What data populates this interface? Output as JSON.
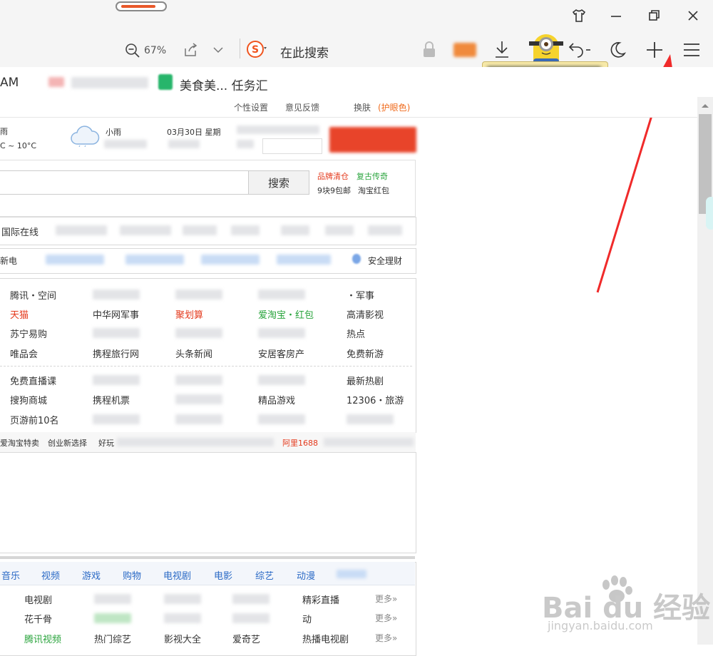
{
  "browser": {
    "zoom": "67%",
    "search_placeholder": "在此搜索",
    "bookmarks": [
      "AM",
      "美食美... 任务汇"
    ]
  },
  "topbar": {
    "settings_links": [
      "个性设置",
      "意见反馈",
      "换肤",
      "(护眼色)"
    ]
  },
  "weather": {
    "today_temp": "C ~ 10°C",
    "cond1": "雨",
    "cond2": "小雨",
    "date": "03月30日 星期"
  },
  "search": {
    "button": "搜索",
    "promo": [
      {
        "text": "品牌清仓",
        "color": "red"
      },
      {
        "text": "复古传奇",
        "color": "green"
      },
      {
        "text": "9块9包邮",
        "color": "normal"
      },
      {
        "text": "淘宝红包",
        "color": "normal"
      }
    ]
  },
  "nav1": {
    "items": [
      "国际在线",
      "中国日报网",
      "人民网"
    ]
  },
  "nav2": {
    "items": [
      "新电",
      "安全理财"
    ]
  },
  "sites": {
    "rows": [
      [
        "腾讯・空间",
        "",
        "",
        "",
        "・军事"
      ],
      [
        "天猫",
        "中华网军事",
        "聚划算",
        "爱淘宝・红包",
        "高清影视"
      ],
      [
        "苏宁易购",
        "",
        "",
        "",
        "热点"
      ],
      [
        "唯品会",
        "携程旅行网",
        "头条新闻",
        "安居客房产",
        "免费新游"
      ],
      [
        "免费直播课",
        "",
        "",
        "",
        "最新热剧"
      ],
      [
        "搜狗商城",
        "携程机票",
        "",
        "精品游戏",
        "12306・旅游"
      ],
      [
        "页游前10名",
        "",
        "",
        "",
        ""
      ]
    ],
    "ticker": [
      "爱淘宝特卖",
      "创业新选择",
      "好玩",
      "阿里1688"
    ]
  },
  "video": {
    "tabs": [
      "音乐",
      "视频",
      "游戏",
      "购物",
      "电视剧",
      "电影",
      "综艺",
      "动漫"
    ],
    "rows": [
      [
        "电视剧",
        "",
        "",
        "",
        "精彩直播",
        "更多»"
      ],
      [
        "花千骨",
        "",
        "",
        "",
        "动",
        "更多»"
      ],
      [
        "腾讯视频",
        "热门综艺",
        "影视大全",
        "爱奇艺",
        "热播电视剧",
        "更多»"
      ]
    ]
  },
  "watermark": {
    "brand": "Bai du 经验",
    "url": "jingyan.baidu.com"
  }
}
